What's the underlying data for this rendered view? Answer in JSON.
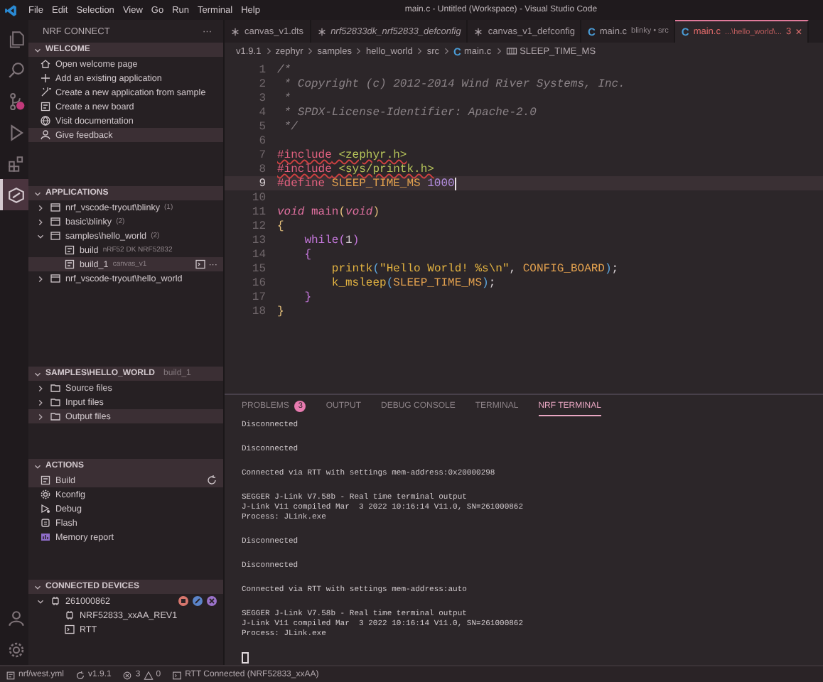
{
  "title_bar": {
    "menu": [
      "File",
      "Edit",
      "Selection",
      "View",
      "Go",
      "Run",
      "Terminal",
      "Help"
    ],
    "title": "main.c - Untitled (Workspace) - Visual Studio Code"
  },
  "activity_bar": [
    {
      "kind": "files",
      "selected": false
    },
    {
      "kind": "search",
      "selected": false
    },
    {
      "kind": "source-control",
      "selected": false
    },
    {
      "kind": "run",
      "selected": false
    },
    {
      "kind": "extensions",
      "selected": false
    },
    {
      "kind": "nrf",
      "selected": true
    },
    {
      "kind": "account",
      "selected": false
    },
    {
      "kind": "settings",
      "selected": false
    }
  ],
  "sidebar": {
    "title": "NRF CONNECT",
    "more": "···",
    "sections": [
      {
        "title": "WELCOME",
        "expanded": true,
        "items": [
          {
            "label": "Open welcome page",
            "selected": false
          },
          {
            "label": "Add an existing application",
            "selected": false
          },
          {
            "label": "Create a new application from sample",
            "selected": false
          },
          {
            "label": "Create a new board",
            "selected": false
          },
          {
            "label": "Visit documentation",
            "selected": false
          },
          {
            "label": "Give feedback",
            "selected": true
          }
        ]
      },
      {
        "title": "APPLICATIONS",
        "expanded": true,
        "items": [
          {
            "label": "nrf_vscode-tryout\\blinky",
            "detail": "(1)",
            "expanded": false,
            "selected": false
          },
          {
            "label": "basic\\blinky",
            "detail": "(2)",
            "expanded": false,
            "selected": false
          },
          {
            "label": "samples\\hello_world",
            "detail": "(2)",
            "expanded": true,
            "selected": false,
            "children": [
              {
                "label": "build",
                "detail": "nRF52 DK NRF52832",
                "selected": false
              },
              {
                "label": "build_1",
                "detail": "canvas_v1",
                "selected": true,
                "more": "···"
              }
            ]
          },
          {
            "label": "nrf_vscode-tryout\\hello_world",
            "expanded": false,
            "selected": false
          }
        ]
      },
      {
        "title": "SAMPLES\\HELLO_WORLD",
        "detail": "build_1",
        "expanded": true,
        "items": [
          {
            "label": "Source files",
            "expanded": false,
            "selected": false
          },
          {
            "label": "Input files",
            "expanded": false,
            "selected": false
          },
          {
            "label": "Output files",
            "expanded": false,
            "selected": true
          }
        ]
      },
      {
        "title": "ACTIONS",
        "expanded": true,
        "items": [
          {
            "label": "Build",
            "selected": true
          },
          {
            "label": "Kconfig",
            "selected": false
          },
          {
            "label": "Debug",
            "selected": false
          },
          {
            "label": "Flash",
            "selected": false
          },
          {
            "label": "Memory report",
            "selected": false
          }
        ]
      },
      {
        "title": "CONNECTED DEVICES",
        "expanded": true,
        "items": [
          {
            "label": "261000862",
            "expanded": true,
            "selected": false,
            "children": [
              {
                "label": "NRF52833_xxAA_REV1",
                "selected": false
              },
              {
                "label": "RTT",
                "selected": false
              }
            ]
          }
        ]
      }
    ]
  },
  "editor": {
    "tabs": [
      {
        "label": "canvas_v1.dts",
        "selected": false,
        "preview": false
      },
      {
        "label": "nrf52833dk_nrf52833_defconfig",
        "selected": false,
        "preview": true
      },
      {
        "label": "canvas_v1_defconfig",
        "selected": false,
        "preview": false
      },
      {
        "letter": "C",
        "label": "main.c",
        "detail": "blinky • src",
        "selected": false,
        "preview": false
      },
      {
        "letter": "C",
        "label": "main.c",
        "detail": "...\\hello_world\\...",
        "problems": "3",
        "close": "×",
        "selected": true,
        "preview": false
      }
    ],
    "breadcrumb": [
      {
        "kind": "folder",
        "text": "v1.9.1"
      },
      {
        "kind": "folder",
        "text": "zephyr"
      },
      {
        "kind": "folder",
        "text": "samples"
      },
      {
        "kind": "folder",
        "text": "hello_world"
      },
      {
        "kind": "folder",
        "text": "src"
      },
      {
        "kind": "file",
        "text": "main.c",
        "letter": "C"
      },
      {
        "kind": "symbol",
        "text": "SLEEP_TIME_MS"
      }
    ],
    "lines": [
      {
        "number": "1",
        "current": false,
        "error": false,
        "tokens": [
          {
            "kind": "comment",
            "text": "/*"
          }
        ]
      },
      {
        "number": "2",
        "current": false,
        "error": false,
        "tokens": [
          {
            "kind": "comment",
            "text": " * Copyright (c) 2012-2014 Wind River Systems, Inc."
          }
        ]
      },
      {
        "number": "3",
        "current": false,
        "error": false,
        "tokens": [
          {
            "kind": "comment",
            "text": " *"
          }
        ]
      },
      {
        "number": "4",
        "current": false,
        "error": false,
        "tokens": [
          {
            "kind": "comment",
            "text": " * SPDX-License-Identifier: Apache-2.0"
          }
        ]
      },
      {
        "number": "5",
        "current": false,
        "error": false,
        "tokens": [
          {
            "kind": "comment",
            "text": " */"
          }
        ]
      },
      {
        "number": "6",
        "current": false
      },
      {
        "number": "7",
        "current": false,
        "error": true,
        "tokens": [
          {
            "kind": "directive",
            "text": "#include"
          },
          {
            "kind": "path",
            "text": " <zephyr.h>"
          }
        ]
      },
      {
        "number": "8",
        "current": false,
        "error": true,
        "tokens": [
          {
            "kind": "directive",
            "text": "#include"
          },
          {
            "kind": "path",
            "text": " <sys/printk.h>"
          }
        ]
      },
      {
        "number": "9",
        "current": true,
        "error": false,
        "tokens": [
          {
            "kind": "directive",
            "text": "#define"
          },
          {
            "kind": "macro",
            "text": " SLEEP_TIME_MS"
          },
          {
            "kind": "number",
            "text": " 1000"
          }
        ]
      },
      {
        "number": "10",
        "current": false
      },
      {
        "number": "11",
        "current": false,
        "error": false,
        "tokens": [
          {
            "kind": "type",
            "text": "void"
          },
          {
            "kind": "function",
            "text": " main"
          },
          {
            "kind": "brace",
            "text": "("
          },
          {
            "kind": "type",
            "text": "void"
          },
          {
            "kind": "brace",
            "text": ")"
          }
        ]
      },
      {
        "number": "12",
        "current": false,
        "error": false,
        "tokens": [
          {
            "kind": "brace",
            "text": "{"
          }
        ]
      },
      {
        "number": "13",
        "current": false,
        "error": false,
        "tokens": [
          {
            "kind": "keyword",
            "text": "    while"
          },
          {
            "kind": "brace2",
            "text": "("
          },
          {
            "kind": "plain",
            "text": "1"
          },
          {
            "kind": "brace2",
            "text": ")"
          }
        ]
      },
      {
        "number": "14",
        "current": false,
        "error": false,
        "tokens": [
          {
            "kind": "brace2",
            "text": "    {"
          }
        ]
      },
      {
        "number": "15",
        "current": false,
        "error": false,
        "tokens": [
          {
            "kind": "call",
            "text": "        printk"
          },
          {
            "kind": "brace3",
            "text": "("
          },
          {
            "kind": "string",
            "text": "\"Hello World! %s\\n\""
          },
          {
            "kind": "plain",
            "text": ", "
          },
          {
            "kind": "macro",
            "text": "CONFIG_BOARD"
          },
          {
            "kind": "brace3",
            "text": ")"
          },
          {
            "kind": "plain",
            "text": ";"
          }
        ]
      },
      {
        "number": "16",
        "current": false,
        "error": false,
        "tokens": [
          {
            "kind": "call",
            "text": "        k_msleep"
          },
          {
            "kind": "brace3",
            "text": "("
          },
          {
            "kind": "macro",
            "text": "SLEEP_TIME_MS"
          },
          {
            "kind": "brace3",
            "text": ")"
          },
          {
            "kind": "plain",
            "text": ";"
          }
        ]
      },
      {
        "number": "17",
        "current": false,
        "error": false,
        "tokens": [
          {
            "kind": "brace2",
            "text": "    }"
          }
        ]
      },
      {
        "number": "18",
        "current": false,
        "error": false,
        "tokens": [
          {
            "kind": "brace",
            "text": "}"
          }
        ]
      }
    ]
  },
  "panel": {
    "tabs": [
      {
        "label": "PROBLEMS",
        "badge": "3",
        "selected": false
      },
      {
        "label": "OUTPUT",
        "selected": false
      },
      {
        "label": "DEBUG CONSOLE",
        "selected": false
      },
      {
        "label": "TERMINAL",
        "selected": false
      },
      {
        "label": "NRF TERMINAL",
        "selected": true
      }
    ],
    "blocks": [
      [
        "Disconnected"
      ],
      [
        "Disconnected"
      ],
      [
        "Connected via RTT with settings mem-address:0x20000298"
      ],
      [
        "SEGGER J-Link V7.58b - Real time terminal output",
        "J-Link V11 compiled Mar  3 2022 10:16:14 V11.0, SN=261000862",
        "Process: JLink.exe"
      ],
      [
        "Disconnected"
      ],
      [
        "Disconnected"
      ],
      [
        "Connected via RTT with settings mem-address:auto"
      ],
      [
        "SEGGER J-Link V7.58b - Real time terminal output",
        "J-Link V11 compiled Mar  3 2022 10:16:14 V11.0, SN=261000862",
        "Process: JLink.exe"
      ]
    ]
  },
  "status_bar": {
    "manifest": "nrf/west.yml",
    "version": "v1.9.1",
    "errors": "3",
    "warnings": "0",
    "rtt": "RTT Connected (NRF52833_xxAA)"
  }
}
